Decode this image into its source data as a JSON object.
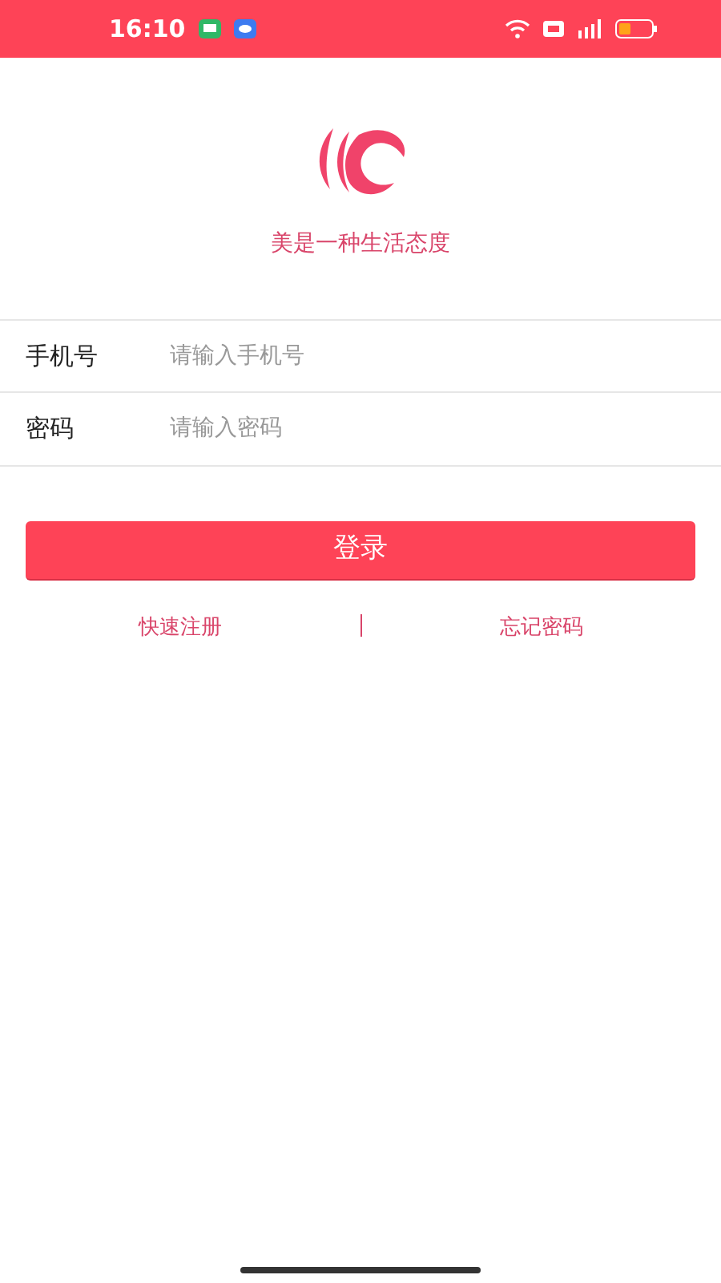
{
  "status_bar": {
    "time": "16:10"
  },
  "slogan": "美是一种生活态度",
  "fields": [
    {
      "label": "手机号",
      "placeholder": "请输入手机号"
    },
    {
      "label": "密码",
      "placeholder": "请输入密码"
    }
  ],
  "login_button": "登录",
  "links": [
    "快速注册",
    "忘记密码"
  ]
}
